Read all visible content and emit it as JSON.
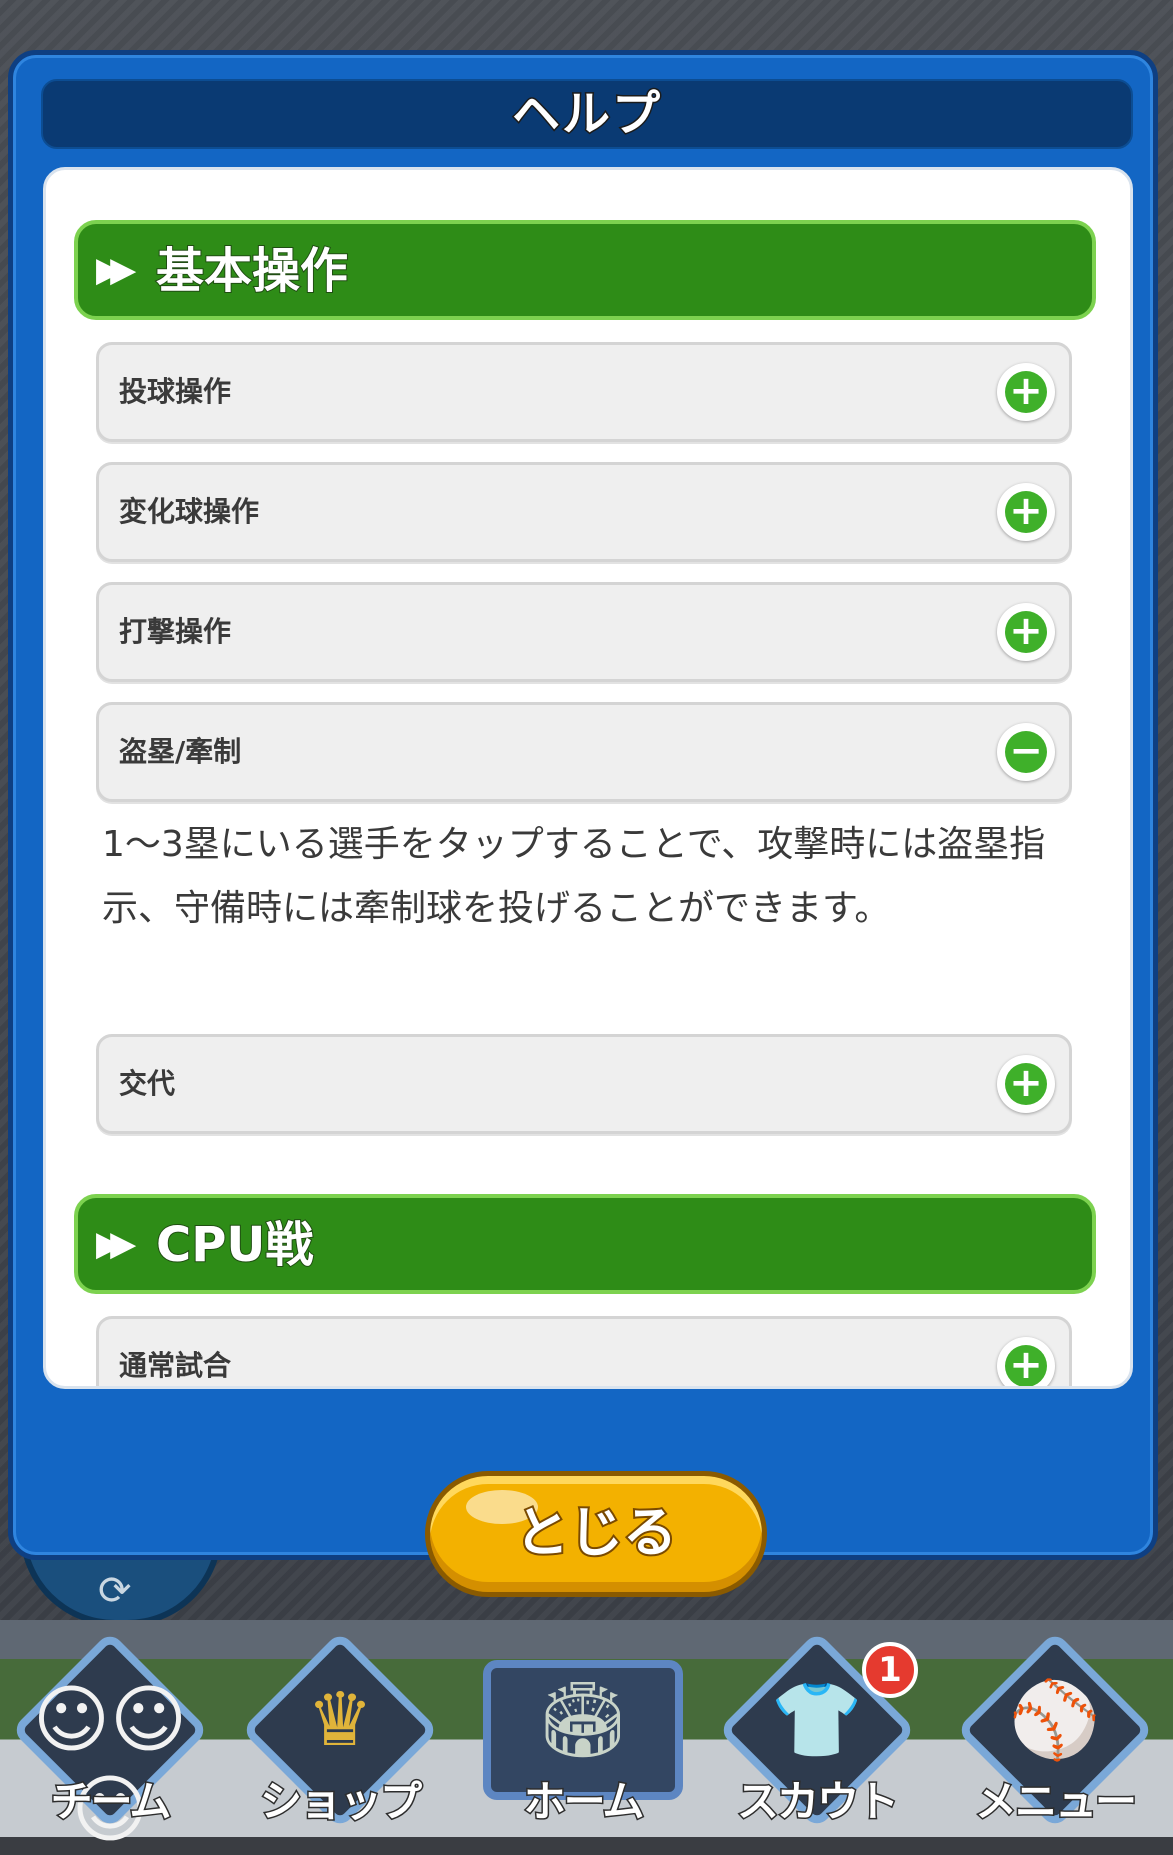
{
  "modal": {
    "title": "ヘルプ",
    "close_label": "とじる"
  },
  "sections": [
    {
      "title": "基本操作",
      "items": [
        {
          "label": "投球操作",
          "toggle": "+"
        },
        {
          "label": "変化球操作",
          "toggle": "+"
        },
        {
          "label": "打撃操作",
          "toggle": "+"
        },
        {
          "label": "盗塁/牽制",
          "toggle": "−"
        },
        {
          "label": "交代",
          "toggle": "+"
        }
      ],
      "expanded_text": "1〜3塁にいる選手をタップすることで、攻撃時には盗塁指示、守備時には牽制球を投げることができます。"
    },
    {
      "title": "CPU戦",
      "items": [
        {
          "label": "通常試合",
          "toggle": "+"
        }
      ]
    }
  ],
  "bottom_nav": {
    "items": [
      {
        "label": "チーム",
        "icon": "team-icon"
      },
      {
        "label": "ショップ",
        "icon": "trophy-icon"
      },
      {
        "label": "ホーム",
        "icon": "stadium-icon"
      },
      {
        "label": "スカウト",
        "icon": "jersey-icon",
        "badge": "1"
      },
      {
        "label": "メニュー",
        "icon": "bat-helmet-icon"
      }
    ]
  },
  "colors": {
    "modal_blue": "#1366c4",
    "section_green": "#2e8c17",
    "toggle_green": "#3fb02a",
    "close_yellow": "#f3b100",
    "badge_red": "#e53a2f"
  }
}
